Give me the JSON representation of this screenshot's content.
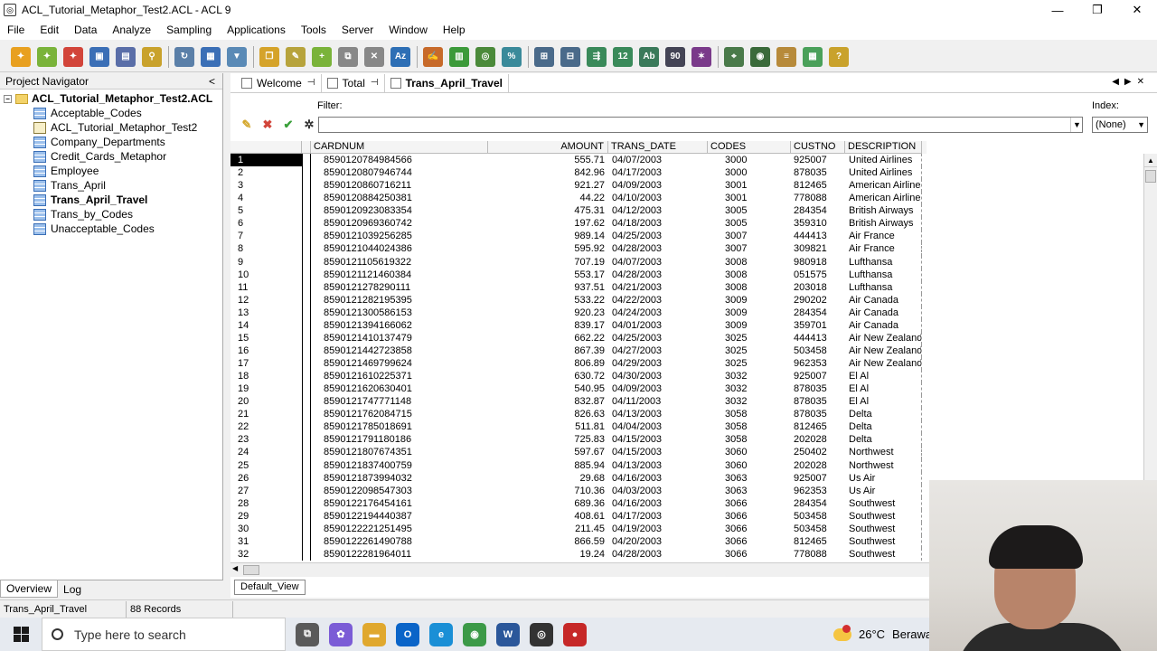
{
  "window": {
    "title": "ACL_Tutorial_Metaphor_Test2.ACL - ACL 9",
    "controls": [
      "—",
      "❐",
      "✕"
    ]
  },
  "menu": [
    "File",
    "Edit",
    "Data",
    "Analyze",
    "Sampling",
    "Applications",
    "Tools",
    "Server",
    "Window",
    "Help"
  ],
  "toolbar_icons": [
    {
      "name": "open-project-icon",
      "color": "#e8a020",
      "glyph": "✦"
    },
    {
      "name": "new-project-icon",
      "color": "#7ab33a",
      "glyph": "✦"
    },
    {
      "name": "close-project-icon",
      "color": "#d2453a",
      "glyph": "✦"
    },
    {
      "name": "save-icon",
      "color": "#3b6fb6",
      "glyph": "▣"
    },
    {
      "name": "print-icon",
      "color": "#5a6ea8",
      "glyph": "▤"
    },
    {
      "name": "find-icon",
      "color": "#c9a22c",
      "glyph": "⚲"
    },
    {
      "name": "refresh-icon",
      "color": "#5a7fa8",
      "glyph": "↻"
    },
    {
      "name": "table-icon",
      "color": "#3b6fb6",
      "glyph": "▦"
    },
    {
      "name": "filter-icon",
      "color": "#5a8ab6",
      "glyph": "▼"
    },
    {
      "name": "copy-icon",
      "color": "#d5a32a",
      "glyph": "❐"
    },
    {
      "name": "edit-icon",
      "color": "#b7a33c",
      "glyph": "✎"
    },
    {
      "name": "add-column-icon",
      "color": "#7ab33a",
      "glyph": "+"
    },
    {
      "name": "edit-layout-icon",
      "color": "#888888",
      "glyph": "⧉"
    },
    {
      "name": "remove-column-icon",
      "color": "#888888",
      "glyph": "✕"
    },
    {
      "name": "az-sort-icon",
      "color": "#2e6fb5",
      "glyph": "Az"
    },
    {
      "name": "script-icon",
      "color": "#c76a2a",
      "glyph": "✍"
    },
    {
      "name": "statistics-icon",
      "color": "#3c9a3a",
      "glyph": "▥"
    },
    {
      "name": "profile-icon",
      "color": "#4b8a3a",
      "glyph": "◎"
    },
    {
      "name": "percent-icon",
      "color": "#3a8a9a",
      "glyph": "%"
    },
    {
      "name": "classify-icon",
      "color": "#4a6a8a",
      "glyph": "⊞"
    },
    {
      "name": "summarize-icon",
      "color": "#4a6a8a",
      "glyph": "⊟"
    },
    {
      "name": "stratify-icon",
      "color": "#3a8a5a",
      "glyph": "⇶"
    },
    {
      "name": "sequence-icon",
      "color": "#3a8a5a",
      "glyph": "12"
    },
    {
      "name": "duplicates-icon",
      "color": "#3a7a5a",
      "glyph": "Ab"
    },
    {
      "name": "gaps-icon",
      "color": "#445",
      "glyph": "90"
    },
    {
      "name": "sample-icon",
      "color": "#7a3a8a",
      "glyph": "✶"
    },
    {
      "name": "analyze-icon",
      "color": "#4a7a4a",
      "glyph": "⌖"
    },
    {
      "name": "verify-icon",
      "color": "#3a6a3a",
      "glyph": "◉"
    },
    {
      "name": "join-icon",
      "color": "#b78a3a",
      "glyph": "≡"
    },
    {
      "name": "colors-icon",
      "color": "#4aa05a",
      "glyph": "▦"
    },
    {
      "name": "help-icon",
      "color": "#c9a22c",
      "glyph": "?"
    }
  ],
  "navigator": {
    "title": "Project Navigator",
    "collapse": "<",
    "project": "ACL_Tutorial_Metaphor_Test2.ACL",
    "items": [
      {
        "label": "Acceptable_Codes",
        "type": "table"
      },
      {
        "label": "ACL_Tutorial_Metaphor_Test2",
        "type": "script"
      },
      {
        "label": "Company_Departments",
        "type": "table"
      },
      {
        "label": "Credit_Cards_Metaphor",
        "type": "table"
      },
      {
        "label": "Employee",
        "type": "table"
      },
      {
        "label": "Trans_April",
        "type": "table"
      },
      {
        "label": "Trans_April_Travel",
        "type": "table",
        "selected": true
      },
      {
        "label": "Trans_by_Codes",
        "type": "table"
      },
      {
        "label": "Unacceptable_Codes",
        "type": "table"
      }
    ],
    "tabs": [
      "Overview",
      "Log"
    ]
  },
  "tabs": [
    "Welcome",
    "Total",
    "Trans_April_Travel"
  ],
  "filter": {
    "label": "Filter:",
    "value": ""
  },
  "index": {
    "label": "Index:",
    "value": "(None)"
  },
  "columns": [
    "CARDNUM",
    "AMOUNT",
    "TRANS_DATE",
    "CODES",
    "CUSTNO",
    "DESCRIPTION"
  ],
  "rows": [
    [
      "8590120784984566",
      "555.71",
      "04/07/2003",
      "3000",
      "925007",
      "United Airlines"
    ],
    [
      "8590120807946744",
      "842.96",
      "04/17/2003",
      "3000",
      "878035",
      "United Airlines"
    ],
    [
      "8590120860716211",
      "921.27",
      "04/09/2003",
      "3001",
      "812465",
      "American Airlines"
    ],
    [
      "8590120884250381",
      "44.22",
      "04/10/2003",
      "3001",
      "778088",
      "American Airlines"
    ],
    [
      "8590120923083354",
      "475.31",
      "04/12/2003",
      "3005",
      "284354",
      "British Airways"
    ],
    [
      "8590120969360742",
      "197.62",
      "04/18/2003",
      "3005",
      "359310",
      "British Airways"
    ],
    [
      "8590121039256285",
      "989.14",
      "04/25/2003",
      "3007",
      "444413",
      "Air France"
    ],
    [
      "8590121044024386",
      "595.92",
      "04/28/2003",
      "3007",
      "309821",
      "Air France"
    ],
    [
      "8590121105619322",
      "707.19",
      "04/07/2003",
      "3008",
      "980918",
      "Lufthansa"
    ],
    [
      "8590121121460384",
      "553.17",
      "04/28/2003",
      "3008",
      "051575",
      "Lufthansa"
    ],
    [
      "8590121278290111",
      "937.51",
      "04/21/2003",
      "3008",
      "203018",
      "Lufthansa"
    ],
    [
      "8590121282195395",
      "533.22",
      "04/22/2003",
      "3009",
      "290202",
      "Air Canada"
    ],
    [
      "8590121300586153",
      "920.23",
      "04/24/2003",
      "3009",
      "284354",
      "Air Canada"
    ],
    [
      "8590121394166062",
      "839.17",
      "04/01/2003",
      "3009",
      "359701",
      "Air Canada"
    ],
    [
      "8590121410137479",
      "662.22",
      "04/25/2003",
      "3025",
      "444413",
      "Air New Zealand"
    ],
    [
      "8590121442723858",
      "867.39",
      "04/27/2003",
      "3025",
      "503458",
      "Air New Zealand"
    ],
    [
      "8590121469799624",
      "806.89",
      "04/29/2003",
      "3025",
      "962353",
      "Air New Zealand"
    ],
    [
      "8590121610225371",
      "630.72",
      "04/30/2003",
      "3032",
      "925007",
      "El Al"
    ],
    [
      "8590121620630401",
      "540.95",
      "04/09/2003",
      "3032",
      "878035",
      "El Al"
    ],
    [
      "8590121747771148",
      "832.87",
      "04/11/2003",
      "3032",
      "878035",
      "El Al"
    ],
    [
      "8590121762084715",
      "826.63",
      "04/13/2003",
      "3058",
      "878035",
      "Delta"
    ],
    [
      "8590121785018691",
      "511.81",
      "04/04/2003",
      "3058",
      "812465",
      "Delta"
    ],
    [
      "8590121791180186",
      "725.83",
      "04/15/2003",
      "3058",
      "202028",
      "Delta"
    ],
    [
      "8590121807674351",
      "597.67",
      "04/15/2003",
      "3060",
      "250402",
      "Northwest"
    ],
    [
      "8590121837400759",
      "885.94",
      "04/13/2003",
      "3060",
      "202028",
      "Northwest"
    ],
    [
      "8590121873994032",
      "29.68",
      "04/16/2003",
      "3063",
      "925007",
      "Us Air"
    ],
    [
      "8590122098547303",
      "710.36",
      "04/03/2003",
      "3063",
      "962353",
      "Us Air"
    ],
    [
      "8590122176454161",
      "689.36",
      "04/16/2003",
      "3066",
      "284354",
      "Southwest"
    ],
    [
      "8590122194440387",
      "408.61",
      "04/17/2003",
      "3066",
      "503458",
      "Southwest"
    ],
    [
      "8590122221251495",
      "211.45",
      "04/19/2003",
      "3066",
      "503458",
      "Southwest"
    ],
    [
      "8590122261490788",
      "866.59",
      "04/20/2003",
      "3066",
      "812465",
      "Southwest"
    ],
    [
      "8590122281964011",
      "19.24",
      "04/28/2003",
      "3066",
      "778088",
      "Southwest"
    ]
  ],
  "selected_row": 1,
  "view_tab": "Default_View",
  "status": {
    "table": "Trans_April_Travel",
    "records": "88 Records"
  },
  "taskbar": {
    "search_placeholder": "Type here to search",
    "weather": "26°C",
    "weather_text": "Berawa",
    "apps": [
      {
        "name": "task-view-icon",
        "color": "#5a5a5a",
        "glyph": "⧉"
      },
      {
        "name": "copilot-icon",
        "color": "#7b5cd6",
        "glyph": "✿"
      },
      {
        "name": "file-explorer-icon",
        "color": "#e0a82e",
        "glyph": "▬"
      },
      {
        "name": "outlook-icon",
        "color": "#0a64c8",
        "glyph": "O"
      },
      {
        "name": "edge-icon",
        "color": "#1a8fd6",
        "glyph": "e"
      },
      {
        "name": "chrome-icon",
        "color": "#3c9a48",
        "glyph": "◉"
      },
      {
        "name": "word-icon",
        "color": "#2b579a",
        "glyph": "W"
      },
      {
        "name": "acl-icon",
        "color": "#333333",
        "glyph": "◎"
      },
      {
        "name": "recorder-icon",
        "color": "#c62828",
        "glyph": "●"
      }
    ]
  }
}
